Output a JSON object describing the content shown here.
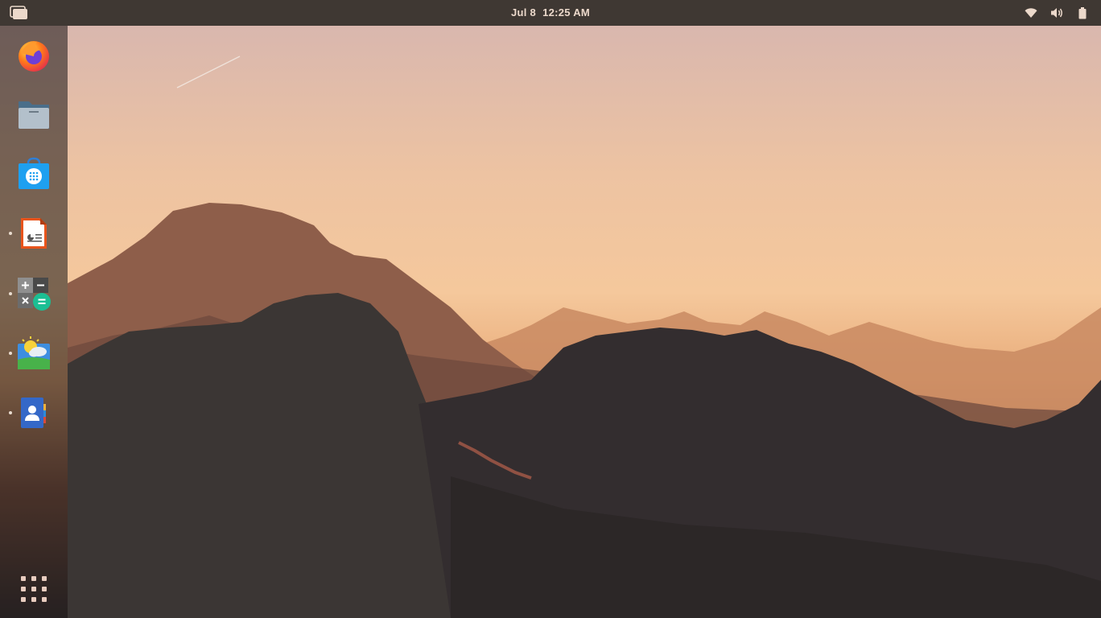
{
  "topbar": {
    "date": "Jul 8",
    "time": "12:25 AM",
    "tray_icons": [
      "wifi-icon",
      "volume-icon",
      "battery-icon"
    ]
  },
  "dock": {
    "items": [
      {
        "name": "firefox",
        "icon": "firefox-icon",
        "running": false
      },
      {
        "name": "files",
        "icon": "folder-icon",
        "running": false
      },
      {
        "name": "software",
        "icon": "store-bag-icon",
        "running": false
      },
      {
        "name": "impress",
        "icon": "presentation-document-icon",
        "running": true
      },
      {
        "name": "calculator",
        "icon": "calculator-icon",
        "running": true
      },
      {
        "name": "weather",
        "icon": "weather-icon",
        "running": true
      },
      {
        "name": "contacts",
        "icon": "contacts-icon",
        "running": true
      }
    ],
    "show_apps_icon": "app-grid-icon"
  },
  "colors": {
    "topbar_bg": "#3f3833",
    "topbar_text": "#ecd9cb",
    "dock_bg": "#161212"
  }
}
